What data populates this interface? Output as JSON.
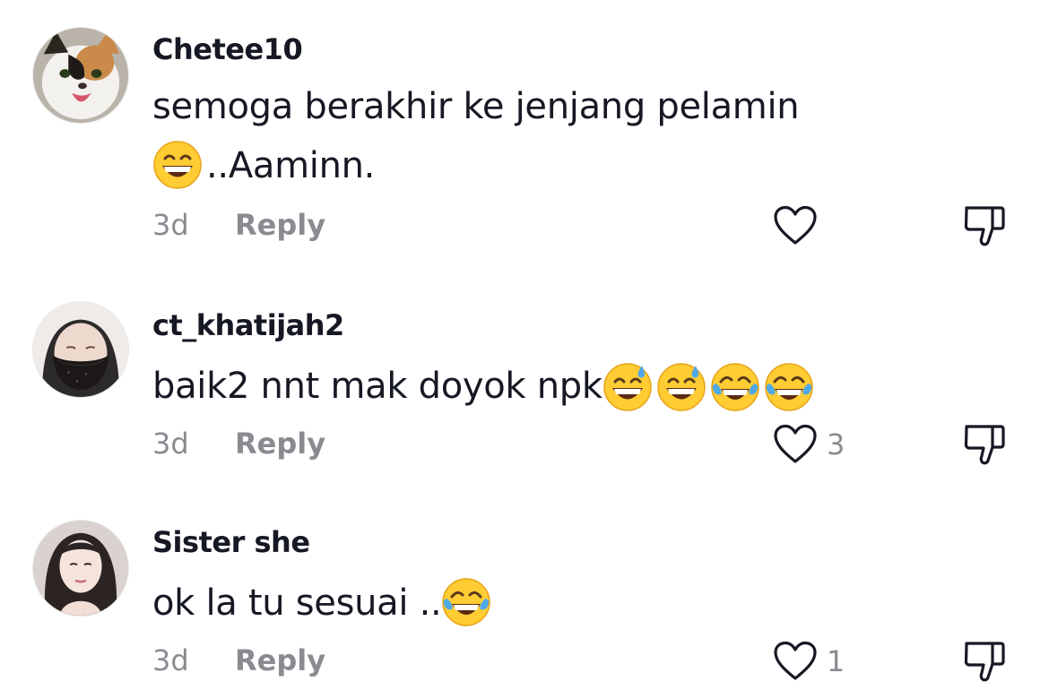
{
  "comments": [
    {
      "username": "Chetee10",
      "text_line1": "semoga berakhir ke jenjang pelamin",
      "text_line2_suffix": "..Aaminn.",
      "emojis": [
        "grinning-face-with-smiling-eyes"
      ],
      "time": "3d",
      "reply_label": "Reply",
      "like_count": "",
      "avatar": "cat-avatar"
    },
    {
      "username": "ct_khatijah2",
      "text": "baik2 nnt mak doyok npk",
      "emojis": [
        "grinning-face-with-sweat",
        "grinning-face-with-sweat",
        "face-with-tears-of-joy",
        "face-with-tears-of-joy"
      ],
      "time": "3d",
      "reply_label": "Reply",
      "like_count": "3",
      "avatar": "person-with-mask-avatar"
    },
    {
      "username": "Sister she",
      "text": "ok la tu sesuai ..",
      "emojis": [
        "face-with-tears-of-joy"
      ],
      "time": "3d",
      "reply_label": "Reply",
      "like_count": "1",
      "avatar": "woman-avatar"
    }
  ],
  "icons": {
    "like": "heart-outline-icon",
    "dislike": "thumbs-down-outline-icon"
  },
  "colors": {
    "text": "#161823",
    "muted": "#8a8b91",
    "icon": "#161823"
  }
}
